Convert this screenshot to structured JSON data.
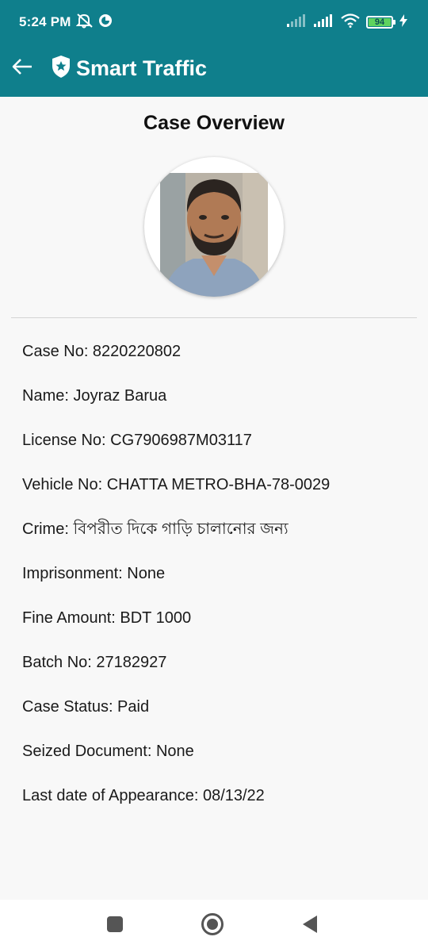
{
  "status_bar": {
    "time": "5:24 PM",
    "battery_level": "94",
    "icons": [
      "mute-icon",
      "notification-icon",
      "signal-icon",
      "signal-icon",
      "wifi-icon",
      "battery-icon",
      "charging-icon"
    ]
  },
  "app_bar": {
    "title": "Smart Traffic",
    "back_icon": "arrow-left-icon",
    "logo_icon": "shield-star-icon",
    "color": "#0f7f8c"
  },
  "page": {
    "heading": "Case Overview"
  },
  "details": [
    {
      "label": "Case No: 8220220802"
    },
    {
      "label": "Name: Joyraz Barua"
    },
    {
      "label": "License No: CG7906987M03117"
    },
    {
      "label": "Vehicle No: CHATTA METRO-BHA-78-0029"
    },
    {
      "label": "Crime: বিপরীত দিকে গাড়ি চালানোর জন্য"
    },
    {
      "label": "Imprisonment: None"
    },
    {
      "label": "Fine Amount: BDT 1000"
    },
    {
      "label": "Batch No: 27182927"
    },
    {
      "label": "Case Status: Paid"
    },
    {
      "label": "Seized Document: None"
    },
    {
      "label": "Last date of Appearance: 08/13/22"
    }
  ],
  "nav_bar": {
    "buttons": [
      "recent-apps-icon",
      "home-icon",
      "back-triangle-icon"
    ]
  }
}
